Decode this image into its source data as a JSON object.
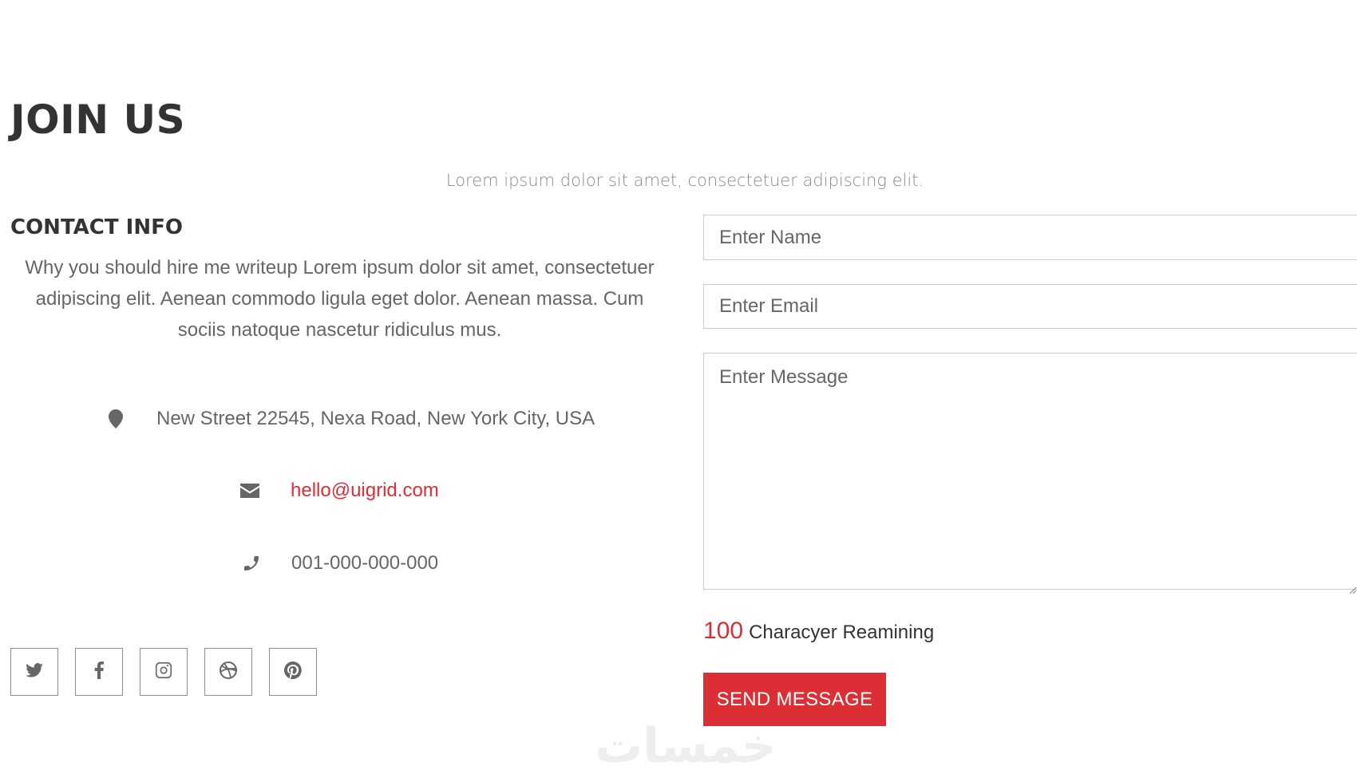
{
  "header": {
    "title": "JOIN US",
    "subtitle": "Lorem ipsum dolor sit amet, consectetuer adipiscing elit."
  },
  "contact": {
    "heading": "CONTACT INFO",
    "intro": "Why you should hire me writeup Lorem ipsum dolor sit amet, consectetuer adipiscing elit. Aenean commodo ligula eget dolor. Aenean massa. Cum sociis natoque nascetur ridiculus mus.",
    "address": "New Street 22545, Nexa Road, New York City, USA",
    "email": "hello@uigrid.com",
    "phone": "001-000-000-000",
    "icons": [
      "map-pin-icon",
      "envelope-icon",
      "phone-icon"
    ]
  },
  "socials": [
    {
      "name": "twitter",
      "icon": "twitter-icon"
    },
    {
      "name": "facebook",
      "icon": "facebook-icon"
    },
    {
      "name": "instagram",
      "icon": "instagram-icon"
    },
    {
      "name": "dribbble",
      "icon": "dribbble-icon"
    },
    {
      "name": "pinterest",
      "icon": "pinterest-icon"
    }
  ],
  "form": {
    "name_placeholder": "Enter Name",
    "email_placeholder": "Enter Email",
    "message_placeholder": "Enter Message",
    "counter_value": "100",
    "counter_label": "Characyer Reamining",
    "send_label": "SEND MESSAGE"
  },
  "watermark": "خمسات",
  "colors": {
    "accent": "#dc2e35",
    "heading": "#333333",
    "text": "#666666",
    "border": "#cccccc"
  }
}
